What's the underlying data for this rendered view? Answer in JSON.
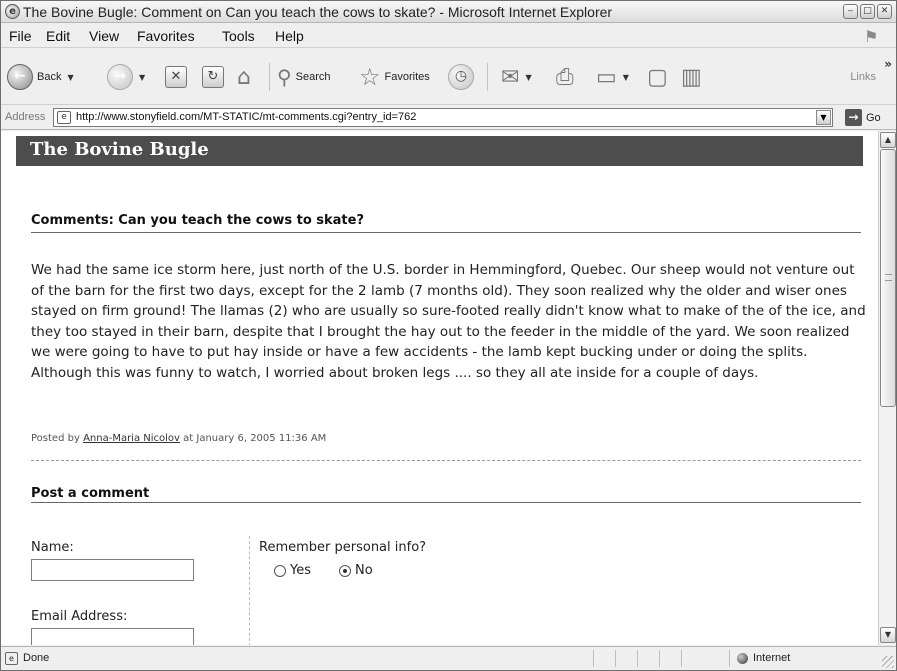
{
  "window": {
    "title": "The Bovine Bugle: Comment on Can you teach the cows to skate? - Microsoft Internet Explorer",
    "controls": {
      "minimize": "‒",
      "maximize": "□",
      "close": "✕"
    }
  },
  "menu": {
    "items": [
      "File",
      "Edit",
      "View",
      "Favorites",
      "Tools",
      "Help"
    ]
  },
  "toolbar": {
    "back_label": "Back",
    "search_label": "Search",
    "favorites_label": "Favorites",
    "links_label": "Links"
  },
  "address": {
    "label": "Address",
    "url": "http://www.stonyfield.com/MT-STATIC/mt-comments.cgi?entry_id=762",
    "go_label": "Go"
  },
  "page": {
    "blog_title": "The Bovine Bugle",
    "comments_heading": "Comments: Can you teach the cows to skate?",
    "comment_text": "We had the same ice storm here, just north of the U.S. border in Hemmingford, Quebec. Our sheep would not venture out of the barn for the first two days, except for the 2 lamb (7 months old). They soon realized why the older and wiser ones stayed on firm ground! The llamas (2) who are usually so sure-footed really didn't know what to make of the of the ice, and they too stayed in their barn, despite that I brought the hay out to the feeder in the middle of the yard. We soon realized we were going to have to put hay inside or have a few accidents - the lamb kept bucking under or doing the splits. Although this was funny to watch, I worried about broken legs .... so they all ate inside for a couple of days.",
    "posted_prefix": "Posted by",
    "posted_author": "Anna-Maria Nicolov",
    "posted_suffix": "at January 6, 2005 11:36 AM",
    "post_heading": "Post a comment",
    "form": {
      "name_label": "Name:",
      "name_value": "",
      "email_label": "Email Address:",
      "email_value": "",
      "remember_label": "Remember personal info?",
      "yes_label": "Yes",
      "no_label": "No",
      "selected": "No"
    }
  },
  "status": {
    "text": "Done",
    "zone": "Internet"
  }
}
